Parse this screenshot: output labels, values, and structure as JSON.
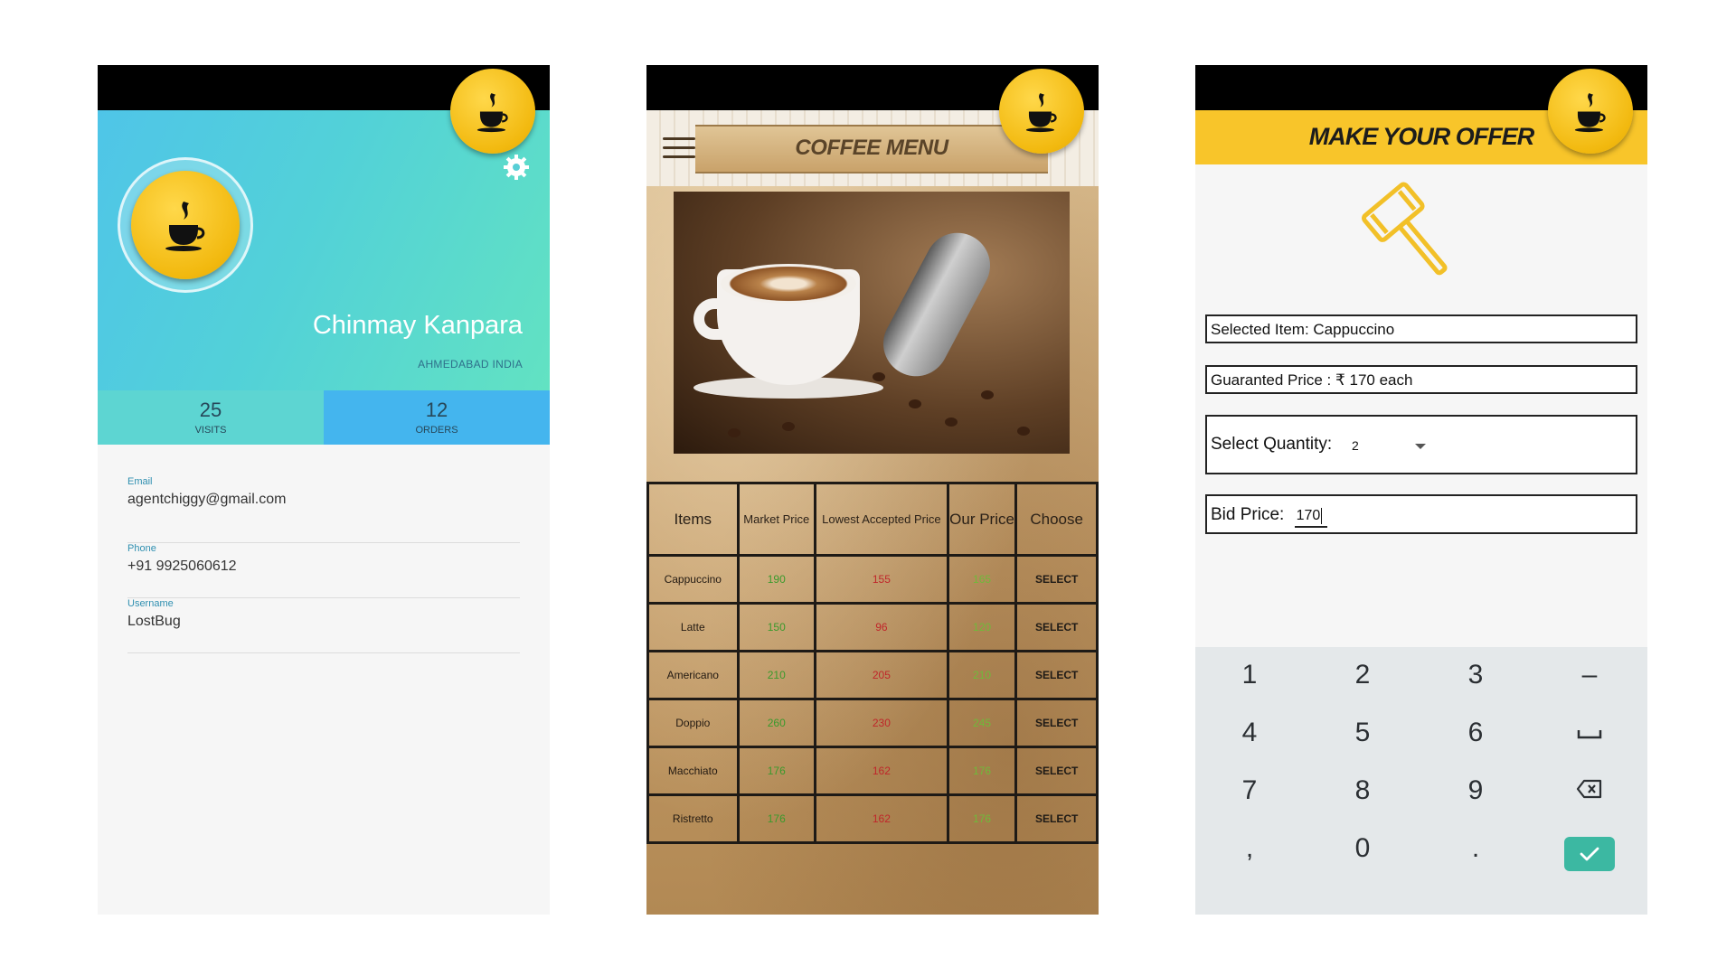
{
  "profile": {
    "name": "Chinmay Kanpara",
    "location": "AHMEDABAD INDIA",
    "stats": [
      {
        "value": "25",
        "label": "VISITS"
      },
      {
        "value": "12",
        "label": "ORDERS"
      }
    ],
    "fields": [
      {
        "label": "Email",
        "value": "agentchiggy@gmail.com"
      },
      {
        "label": "Phone",
        "value": "+91 9925060612"
      },
      {
        "label": "Username",
        "value": "LostBug"
      }
    ]
  },
  "menu": {
    "title": "COFFEE MENU",
    "headers": [
      "Items",
      "Market Price",
      "Lowest Accepted Price",
      "Our Price",
      "Choose"
    ],
    "rows": [
      {
        "item": "Cappuccino",
        "market": "190",
        "lowest": "155",
        "our": "165",
        "action": "SELECT"
      },
      {
        "item": "Latte",
        "market": "150",
        "lowest": "96",
        "our": "120",
        "action": "SELECT"
      },
      {
        "item": "Americano",
        "market": "210",
        "lowest": "205",
        "our": "210",
        "action": "SELECT"
      },
      {
        "item": "Doppio",
        "market": "260",
        "lowest": "230",
        "our": "245",
        "action": "SELECT"
      },
      {
        "item": "Macchiato",
        "market": "176",
        "lowest": "162",
        "our": "176",
        "action": "SELECT"
      },
      {
        "item": "Ristretto",
        "market": "176",
        "lowest": "162",
        "our": "176",
        "action": "SELECT"
      }
    ]
  },
  "offer": {
    "title": "MAKE YOUR OFFER",
    "selected_item": "Selected Item: Cappuccino",
    "guaranteed_price": "Guaranted Price : ₹ 170 each",
    "quantity_label": "Select Quantity:",
    "quantity_value": "2",
    "bid_label": "Bid Price:",
    "bid_value": "170",
    "keypad": [
      [
        "1",
        "2",
        "3",
        "–"
      ],
      [
        "4",
        "5",
        "6",
        "␣"
      ],
      [
        "7",
        "8",
        "9",
        "⌫"
      ],
      [
        ",",
        "0",
        ".",
        "✓"
      ]
    ]
  },
  "icons": {
    "logo": "coffee-cup-logo-icon",
    "settings": "gear-icon",
    "menu": "hamburger-icon",
    "gavel": "gavel-icon",
    "backspace": "backspace-icon",
    "done": "check-icon"
  },
  "colors": {
    "profile_gradient": [
      "#4fc5e8",
      "#62e2c2"
    ],
    "visits_bg": "#5dd5d2",
    "orders_bg": "#44b5ee",
    "offer_header": "#f8c52a",
    "market_price": "#3a9a2c",
    "lowest_price": "#c0262a",
    "our_price": "#6fba3a",
    "done_key": "#3cb8a2"
  }
}
